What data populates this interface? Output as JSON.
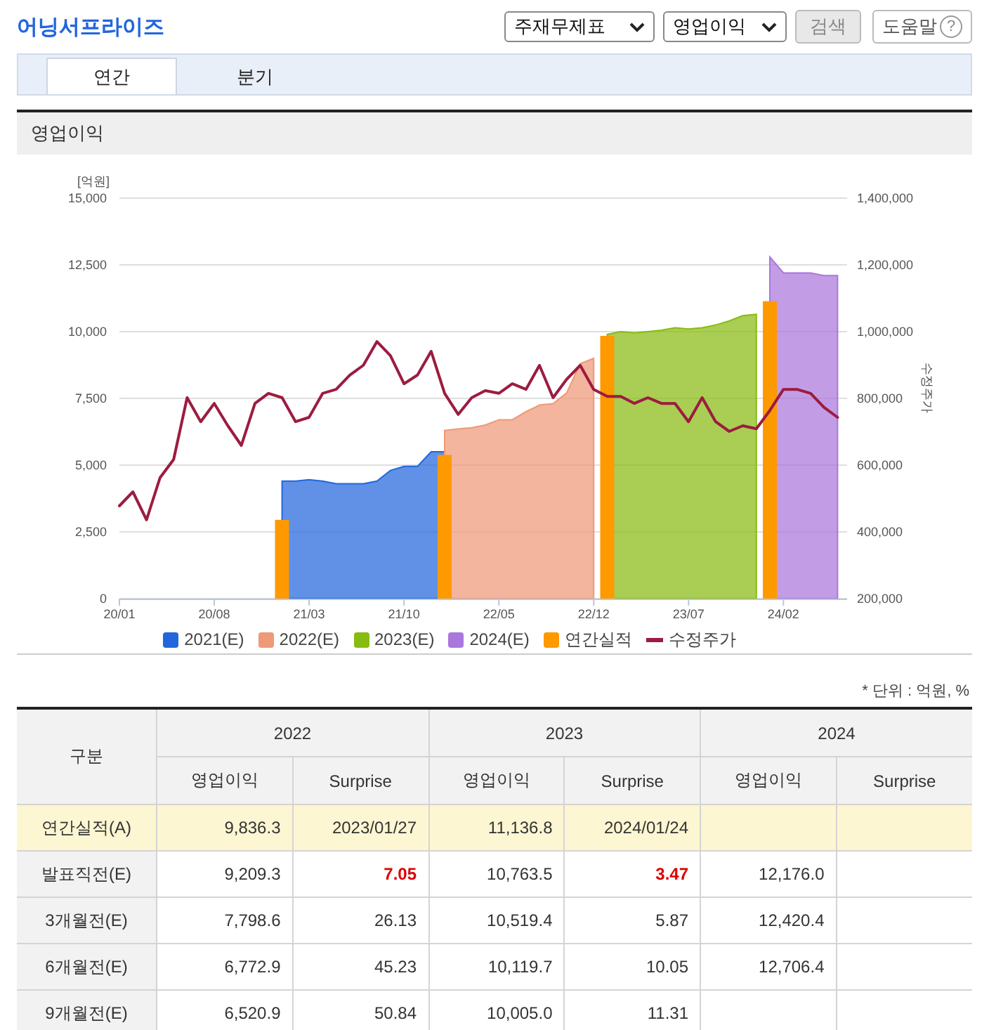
{
  "header": {
    "title": "어닝서프라이즈",
    "selects": [
      {
        "value": "주재무제표"
      },
      {
        "value": "영업이익"
      }
    ],
    "search_button": {
      "label": "검색",
      "disabled": true
    },
    "help_button": {
      "label": "도움말",
      "icon_text": "?"
    }
  },
  "tabs": [
    {
      "label": "연간",
      "selected": true
    },
    {
      "label": "분기",
      "selected": false
    }
  ],
  "chart": {
    "title": "영업이익",
    "chart_data": {
      "type": "area",
      "ylabel": "[억원]",
      "y2label": "수정주가",
      "categories": [
        "20/01",
        null,
        null,
        null,
        null,
        null,
        null,
        "20/08",
        null,
        null,
        null,
        null,
        null,
        null,
        "21/03",
        null,
        null,
        null,
        null,
        null,
        null,
        "21/10",
        null,
        null,
        null,
        null,
        null,
        null,
        "22/05",
        null,
        null,
        null,
        null,
        null,
        null,
        "22/12",
        null,
        null,
        null,
        null,
        null,
        null,
        "23/07",
        null,
        null,
        null,
        null,
        null,
        null,
        "24/02",
        null,
        null,
        null,
        null
      ],
      "grid": true,
      "legend": true,
      "ylim": [
        0,
        15000
      ],
      "yticks": [
        {
          "value": 0,
          "label": "0"
        },
        {
          "value": 2500,
          "label": "2,500"
        },
        {
          "value": 5000,
          "label": "5,000"
        },
        {
          "value": 7500,
          "label": "7,500"
        },
        {
          "value": 10000,
          "label": "10,000"
        },
        {
          "value": 12500,
          "label": "12,500"
        },
        {
          "value": 15000,
          "label": "15,000"
        }
      ],
      "y2lim": [
        200000,
        1400000
      ],
      "y2ticks": [
        {
          "value": 200000,
          "label": "200,000"
        },
        {
          "value": 400000,
          "label": "400,000"
        },
        {
          "value": 600000,
          "label": "600,000"
        },
        {
          "value": 800000,
          "label": "800,000"
        },
        {
          "value": 1000000,
          "label": "1,000,000"
        },
        {
          "value": 1200000,
          "label": "1,200,000"
        },
        {
          "value": 1400000,
          "label": "1,400,000"
        }
      ],
      "series": [
        {
          "name": "2021(E)",
          "color": "#2266dd",
          "values": [
            null,
            null,
            null,
            null,
            null,
            null,
            null,
            null,
            null,
            null,
            null,
            null,
            4400,
            4400,
            4450,
            4400,
            4300,
            4300,
            4300,
            4400,
            4800,
            4950,
            4950,
            5500,
            5500,
            null,
            null,
            null,
            null,
            null,
            null,
            null,
            null,
            null,
            null,
            null,
            null,
            null,
            null,
            null,
            null,
            null,
            null,
            null,
            null,
            null,
            null,
            null,
            null,
            null,
            null,
            null,
            null,
            null
          ]
        },
        {
          "name": "2022(E)",
          "color": "#ee9977",
          "values": [
            null,
            null,
            null,
            null,
            null,
            null,
            null,
            null,
            null,
            null,
            null,
            null,
            null,
            null,
            null,
            null,
            null,
            null,
            null,
            null,
            null,
            null,
            null,
            null,
            6300,
            6350,
            6400,
            6500,
            6700,
            6700,
            7000,
            7250,
            7300,
            7700,
            8800,
            9000,
            null,
            null,
            null,
            null,
            null,
            null,
            null,
            null,
            null,
            null,
            null,
            null,
            null,
            null,
            null,
            null,
            null,
            null
          ]
        },
        {
          "name": "2023(E)",
          "color": "#88bb11",
          "values": [
            null,
            null,
            null,
            null,
            null,
            null,
            null,
            null,
            null,
            null,
            null,
            null,
            null,
            null,
            null,
            null,
            null,
            null,
            null,
            null,
            null,
            null,
            null,
            null,
            null,
            null,
            null,
            null,
            null,
            null,
            null,
            null,
            null,
            null,
            null,
            null,
            9900,
            10000,
            9950,
            10000,
            10050,
            10150,
            10100,
            10150,
            10250,
            10400,
            10600,
            10650,
            null,
            null,
            null,
            null,
            null,
            null
          ]
        },
        {
          "name": "2024(E)",
          "color": "#aa77dd",
          "values": [
            null,
            null,
            null,
            null,
            null,
            null,
            null,
            null,
            null,
            null,
            null,
            null,
            null,
            null,
            null,
            null,
            null,
            null,
            null,
            null,
            null,
            null,
            null,
            null,
            null,
            null,
            null,
            null,
            null,
            null,
            null,
            null,
            null,
            null,
            null,
            null,
            null,
            null,
            null,
            null,
            null,
            null,
            null,
            null,
            null,
            null,
            null,
            null,
            12800,
            12200,
            12200,
            12200,
            12100,
            12100
          ]
        },
        {
          "name": "연간실적",
          "type": "bar",
          "color": "#ff9900",
          "values": [
            null,
            null,
            null,
            null,
            null,
            null,
            null,
            null,
            null,
            null,
            null,
            null,
            2950,
            null,
            null,
            null,
            null,
            null,
            null,
            null,
            null,
            null,
            null,
            null,
            5380,
            null,
            null,
            null,
            null,
            null,
            null,
            null,
            null,
            null,
            null,
            null,
            9840,
            null,
            null,
            null,
            null,
            null,
            null,
            null,
            null,
            null,
            null,
            null,
            11140,
            null,
            null,
            null,
            null,
            null
          ]
        },
        {
          "name": "수정주가",
          "type": "line",
          "axis": "y2",
          "color": "#9c1c40",
          "values": [
            478000,
            520000,
            436000,
            562000,
            617000,
            802000,
            730000,
            785000,
            718000,
            659000,
            785000,
            815000,
            802000,
            730000,
            743000,
            815000,
            827000,
            870000,
            899000,
            970000,
            928000,
            844000,
            870000,
            941000,
            815000,
            752000,
            802000,
            823000,
            815000,
            844000,
            827000,
            899000,
            802000,
            857000,
            899000,
            827000,
            806000,
            806000,
            785000,
            802000,
            785000,
            785000,
            730000,
            802000,
            730000,
            701000,
            718000,
            709000,
            764000,
            827000,
            827000,
            815000,
            773000,
            743000
          ]
        }
      ]
    }
  },
  "unit_note": "* 단위 : 억원, %",
  "table": {
    "corner": "구분",
    "years": [
      "2022",
      "2023",
      "2024"
    ],
    "columns": [
      "영업이익",
      "Surprise",
      "영업이익",
      "Surprise",
      "영업이익",
      "Surprise"
    ],
    "rows": [
      {
        "label": "연간실적(A)",
        "kind": "actual",
        "cells": [
          {
            "text": "9,836.3",
            "emphasized": false
          },
          {
            "text": "2023/01/27",
            "emphasized": false
          },
          {
            "text": "11,136.8",
            "emphasized": false
          },
          {
            "text": "2024/01/24",
            "emphasized": false
          },
          null,
          null
        ]
      },
      {
        "label": "발표직전(E)",
        "kind": "estimate",
        "cells": [
          {
            "text": "9,209.3",
            "emphasized": false
          },
          {
            "text": "7.05",
            "emphasized": true
          },
          {
            "text": "10,763.5",
            "emphasized": false
          },
          {
            "text": "3.47",
            "emphasized": true
          },
          {
            "text": "12,176.0",
            "emphasized": false
          },
          null
        ]
      },
      {
        "label": "3개월전(E)",
        "kind": "estimate",
        "cells": [
          {
            "text": "7,798.6",
            "emphasized": false
          },
          {
            "text": "26.13",
            "emphasized": false
          },
          {
            "text": "10,519.4",
            "emphasized": false
          },
          {
            "text": "5.87",
            "emphasized": false
          },
          {
            "text": "12,420.4",
            "emphasized": false
          },
          null
        ]
      },
      {
        "label": "6개월전(E)",
        "kind": "estimate",
        "cells": [
          {
            "text": "6,772.9",
            "emphasized": false
          },
          {
            "text": "45.23",
            "emphasized": false
          },
          {
            "text": "10,119.7",
            "emphasized": false
          },
          {
            "text": "10.05",
            "emphasized": false
          },
          {
            "text": "12,706.4",
            "emphasized": false
          },
          null
        ]
      },
      {
        "label": "9개월전(E)",
        "kind": "estimate",
        "cells": [
          {
            "text": "6,520.9",
            "emphasized": false
          },
          {
            "text": "50.84",
            "emphasized": false
          },
          {
            "text": "10,005.0",
            "emphasized": false
          },
          {
            "text": "11.31",
            "emphasized": false
          },
          null,
          null
        ]
      }
    ]
  }
}
